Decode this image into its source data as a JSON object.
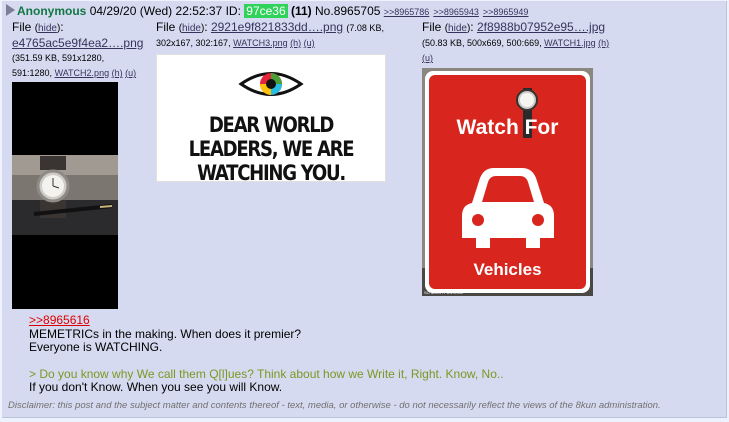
{
  "post": {
    "name": "Anonymous",
    "date": "04/29/20 (Wed) 22:52:37",
    "id_label": "ID:",
    "id": "97ce36",
    "id_count": "(11)",
    "no_label": "No.",
    "no": "8965705",
    "backlinks": [
      ">>8965786",
      ">>8965943",
      ">>8965949"
    ]
  },
  "files": [
    {
      "label": "File",
      "hide": "hide",
      "filename": "e4765ac5e9f4ea2….png",
      "size": "(351.59 KB, 591x1280,",
      "size2": "591:1280,",
      "orig": "WATCH2.png",
      "h": "(h)",
      "u": "(u)"
    },
    {
      "label": "File",
      "hide": "hide",
      "filename": "2921e9f821833dd….png",
      "size": "(7.08 KB,",
      "size2": "302x167, 302:167,",
      "orig": "WATCH3.png",
      "h": "(h)",
      "u": "(u)",
      "image_text": "DEAR WORLD LEADERS, WE ARE WATCHING YOU."
    },
    {
      "label": "File",
      "hide": "hide",
      "filename": "2f8988b07952e95….jpg",
      "size": "(50.83 KB, 500x669, 500:669,",
      "orig": "WATCH1.jpg",
      "h": "(h)",
      "u": "(u)",
      "sign_line1": "Watch For",
      "sign_line2": "Vehicles",
      "watermark": "SO MUCH PUN.COM"
    }
  ],
  "body": {
    "quote": ">>8965616",
    "line1": "MEMETRICs in the making. When does it premier?",
    "line2": "Everyone is WATCHING.",
    "green": "> Do you know why We call them Q[l]ues? Think about how we Write it, Right. Know, No..",
    "line3": "If you don't Know. When you see you will Know."
  },
  "disclaimer": "Disclaimer: this post and the subject matter and contents thereof - text, media, or otherwise - do not necessarily reflect the views of the 8kun administration.",
  "colors": {
    "name": "#117743",
    "id_bg": "#2fd35a",
    "link": "#34345c",
    "quote": "#dd0000",
    "greentext": "#789922",
    "post_bg": "#d6daf0"
  }
}
